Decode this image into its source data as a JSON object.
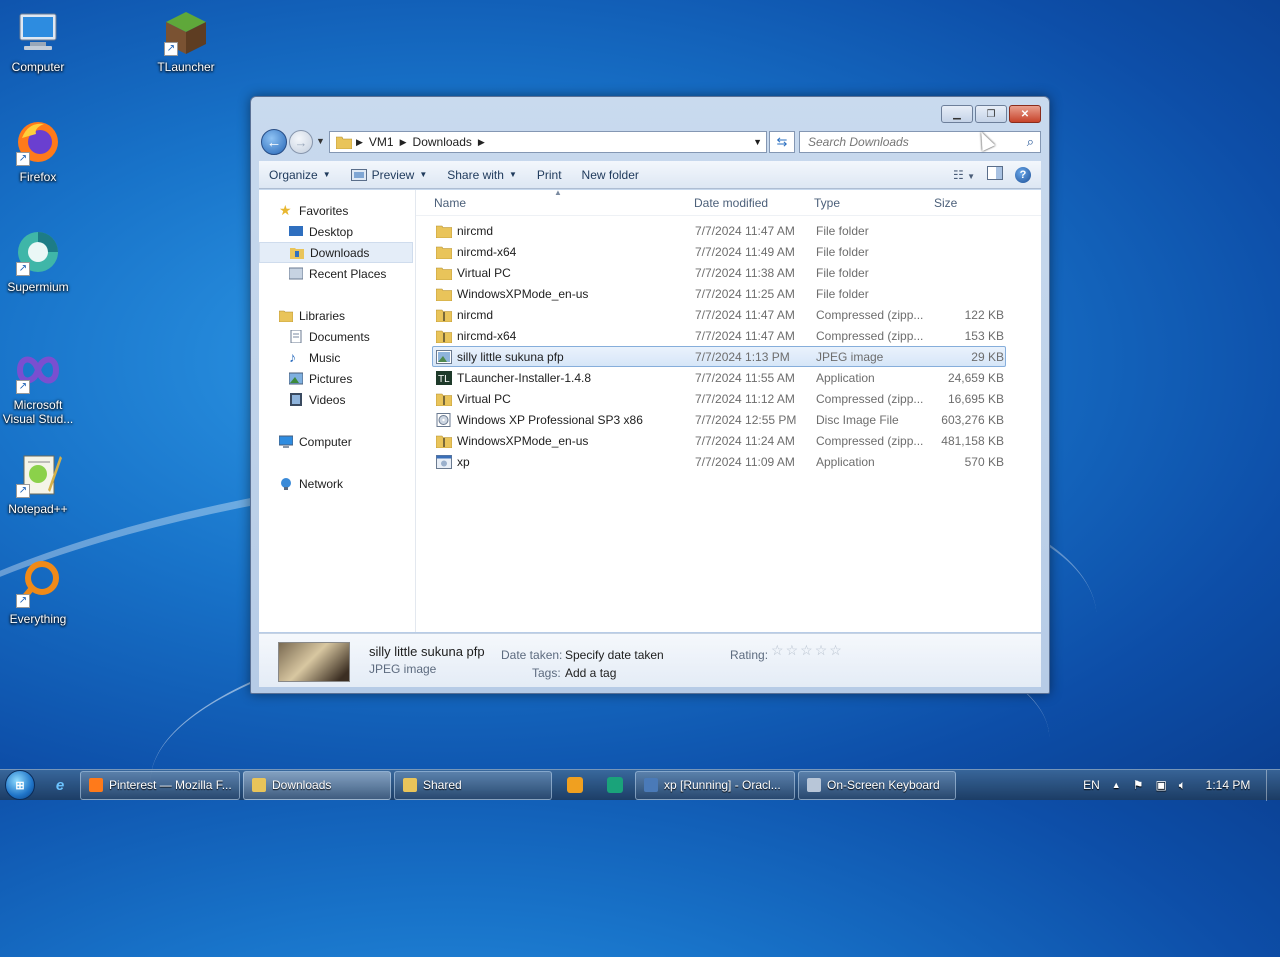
{
  "desktop": {
    "icons": [
      {
        "label": "Computer",
        "icon": "computer-icon"
      },
      {
        "label": "TLauncher",
        "icon": "minecraft-block-icon"
      },
      {
        "label": "Firefox",
        "icon": "firefox-icon"
      },
      {
        "label": "Supermium",
        "icon": "supermium-icon"
      },
      {
        "label": "Microsoft Visual Stud...",
        "icon": "visual-studio-icon"
      },
      {
        "label": "Notepad++",
        "icon": "notepadpp-icon"
      },
      {
        "label": "Everything",
        "icon": "everything-icon"
      }
    ]
  },
  "window": {
    "breadcrumb": [
      "VM1",
      "Downloads"
    ],
    "search_placeholder": "Search Downloads",
    "toolbar": {
      "organize": "Organize",
      "preview": "Preview",
      "share_with": "Share with",
      "print": "Print",
      "new_folder": "New folder"
    },
    "nav": {
      "favorites": "Favorites",
      "desktop": "Desktop",
      "downloads": "Downloads",
      "recent_places": "Recent Places",
      "libraries": "Libraries",
      "documents": "Documents",
      "music": "Music",
      "pictures": "Pictures",
      "videos": "Videos",
      "computer": "Computer",
      "network": "Network"
    },
    "columns": {
      "name": "Name",
      "date": "Date modified",
      "type": "Type",
      "size": "Size"
    },
    "files": [
      {
        "name": "nircmd",
        "date": "7/7/2024 11:47 AM",
        "type": "File folder",
        "size": "",
        "icon": "folder-icon"
      },
      {
        "name": "nircmd-x64",
        "date": "7/7/2024 11:49 AM",
        "type": "File folder",
        "size": "",
        "icon": "folder-icon"
      },
      {
        "name": "Virtual PC",
        "date": "7/7/2024 11:38 AM",
        "type": "File folder",
        "size": "",
        "icon": "folder-icon"
      },
      {
        "name": "WindowsXPMode_en-us",
        "date": "7/7/2024 11:25 AM",
        "type": "File folder",
        "size": "",
        "icon": "folder-icon"
      },
      {
        "name": "nircmd",
        "date": "7/7/2024 11:47 AM",
        "type": "Compressed (zipp...",
        "size": "122 KB",
        "icon": "zip-folder-icon"
      },
      {
        "name": "nircmd-x64",
        "date": "7/7/2024 11:47 AM",
        "type": "Compressed (zipp...",
        "size": "153 KB",
        "icon": "zip-folder-icon"
      },
      {
        "name": "silly little sukuna pfp",
        "date": "7/7/2024 1:13 PM",
        "type": "JPEG image",
        "size": "29 KB",
        "icon": "image-file-icon",
        "selected": true
      },
      {
        "name": "TLauncher-Installer-1.4.8",
        "date": "7/7/2024 11:55 AM",
        "type": "Application",
        "size": "24,659 KB",
        "icon": "tlauncher-icon"
      },
      {
        "name": "Virtual PC",
        "date": "7/7/2024 11:12 AM",
        "type": "Compressed (zipp...",
        "size": "16,695 KB",
        "icon": "zip-folder-icon"
      },
      {
        "name": "Windows XP Professional SP3 x86",
        "date": "7/7/2024 12:55 PM",
        "type": "Disc Image File",
        "size": "603,276 KB",
        "icon": "disc-image-icon"
      },
      {
        "name": "WindowsXPMode_en-us",
        "date": "7/7/2024 11:24 AM",
        "type": "Compressed (zipp...",
        "size": "481,158 KB",
        "icon": "zip-folder-icon"
      },
      {
        "name": "xp",
        "date": "7/7/2024 11:09 AM",
        "type": "Application",
        "size": "570 KB",
        "icon": "application-icon"
      }
    ],
    "details": {
      "name": "silly little sukuna pfp",
      "type": "JPEG image",
      "date_taken_label": "Date taken:",
      "date_taken_value": "Specify date taken",
      "tags_label": "Tags:",
      "tags_value": "Add a tag",
      "rating_label": "Rating:"
    }
  },
  "taskbar": {
    "tasks": [
      {
        "label": "Pinterest — Mozilla F...",
        "icon": "firefox-icon"
      },
      {
        "label": "Downloads",
        "icon": "folder-icon"
      },
      {
        "label": "Shared",
        "icon": "folder-icon"
      },
      {
        "label": "xp [Running] - Oracl...",
        "icon": "virtualbox-icon"
      },
      {
        "label": "On-Screen Keyboard",
        "icon": "keyboard-icon"
      }
    ],
    "language": "EN",
    "time": "1:14 PM"
  }
}
